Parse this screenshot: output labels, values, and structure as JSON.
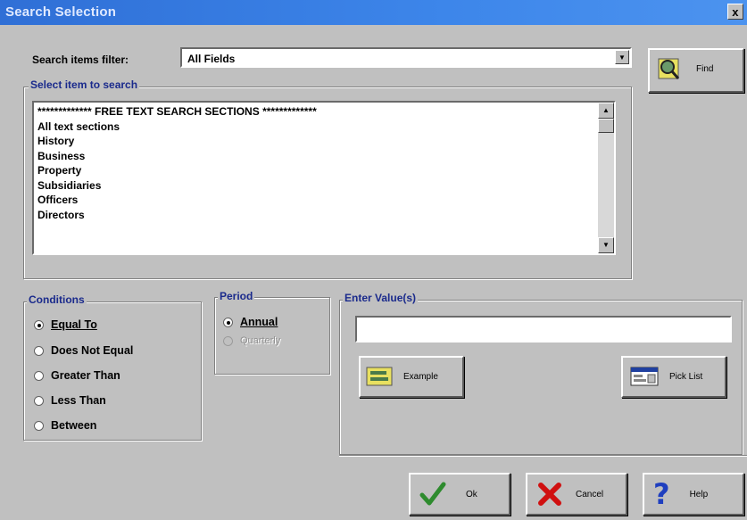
{
  "window": {
    "title": "Search Selection",
    "close_glyph": "x"
  },
  "filter": {
    "label": "Search items filter:",
    "value": "All Fields"
  },
  "find_button": {
    "label": "Find",
    "icon": "magnifier-icon"
  },
  "items_group": {
    "label": "Select item to search",
    "items": [
      "************* FREE TEXT SEARCH SECTIONS *************",
      "All text sections",
      "",
      "History",
      "Business",
      "Property",
      "Subsidiaries",
      "Officers",
      "Directors"
    ]
  },
  "conditions": {
    "label": "Conditions",
    "options": [
      "Equal To",
      "Does Not Equal",
      "Greater Than",
      "Less Than",
      "Between"
    ],
    "selected": "Equal To"
  },
  "period": {
    "label": "Period",
    "options": [
      "Annual",
      "Quarterly"
    ],
    "selected": "Annual"
  },
  "values": {
    "label": "Enter Value(s)",
    "input_value": "",
    "example_label": "Example",
    "picklist_label": "Pick List"
  },
  "footer": {
    "ok_label": "Ok",
    "cancel_label": "Cancel",
    "help_label": "Help",
    "colors": {
      "ok": "#2e8b2e",
      "cancel": "#d01010",
      "help": "#1f3fbf"
    }
  }
}
